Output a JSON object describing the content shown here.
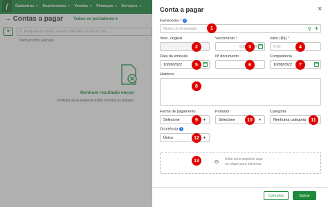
{
  "nav": {
    "logo": "f",
    "items": [
      "Cadastros",
      "Suprimentos",
      "Vendas",
      "Finanças",
      "Serviços"
    ]
  },
  "page": {
    "breadcrumb_arrow": "→",
    "title": "Contas a pagar",
    "scope": "Todos os portadores",
    "search_placeholder": "Pesquise por nome, e-mail, CPF/CNPJ ou Razão Soc",
    "no_filter": "Nenhum filtro aplicado",
    "empty_title": "Nenhum resultado encon",
    "empty_text": "Verifique se as palavras estão corretas ou busque"
  },
  "panel": {
    "title": "Conta a pagar",
    "close": "×",
    "fornecedor_label": "Fornecedor",
    "fornecedor_placeholder": "Nome do fornecedor",
    "venc_original_label": "Venc. original",
    "vencimento_label": "Vencimento",
    "vencimento_placeholder": "00/00/0000",
    "valor_label": "Valor (R$)",
    "valor_placeholder": "0,00",
    "data_emissao_label": "Data da emissão",
    "data_emissao_value": "10/08/2022",
    "n_documento_label": "Nº documento",
    "competencia_label": "Competência",
    "competencia_value": "10/08/2022",
    "historico_label": "Histórico",
    "forma_pagamento_label": "Forma de pagamento",
    "forma_pagamento_value": "Selecione",
    "portador_label": "Portador",
    "portador_value": "Selecione",
    "categoria_label": "Categoria",
    "categoria_value": "Nenhuma categoria",
    "ocorrencia_label": "Ocorrência",
    "ocorrencia_value": "Única",
    "drop_line1": "Solte seus arquivos aqui",
    "drop_line2": "ou clique para adicionar",
    "cancel": "Cancelar",
    "save": "Salvar",
    "required_mark": "*",
    "info_mark": "i"
  },
  "badges": [
    "1",
    "2",
    "3",
    "4",
    "5",
    "6",
    "7",
    "8",
    "9",
    "10",
    "11",
    "12",
    "13"
  ],
  "colors": {
    "brand": "#1e8a3c",
    "badge": "#e00000"
  }
}
